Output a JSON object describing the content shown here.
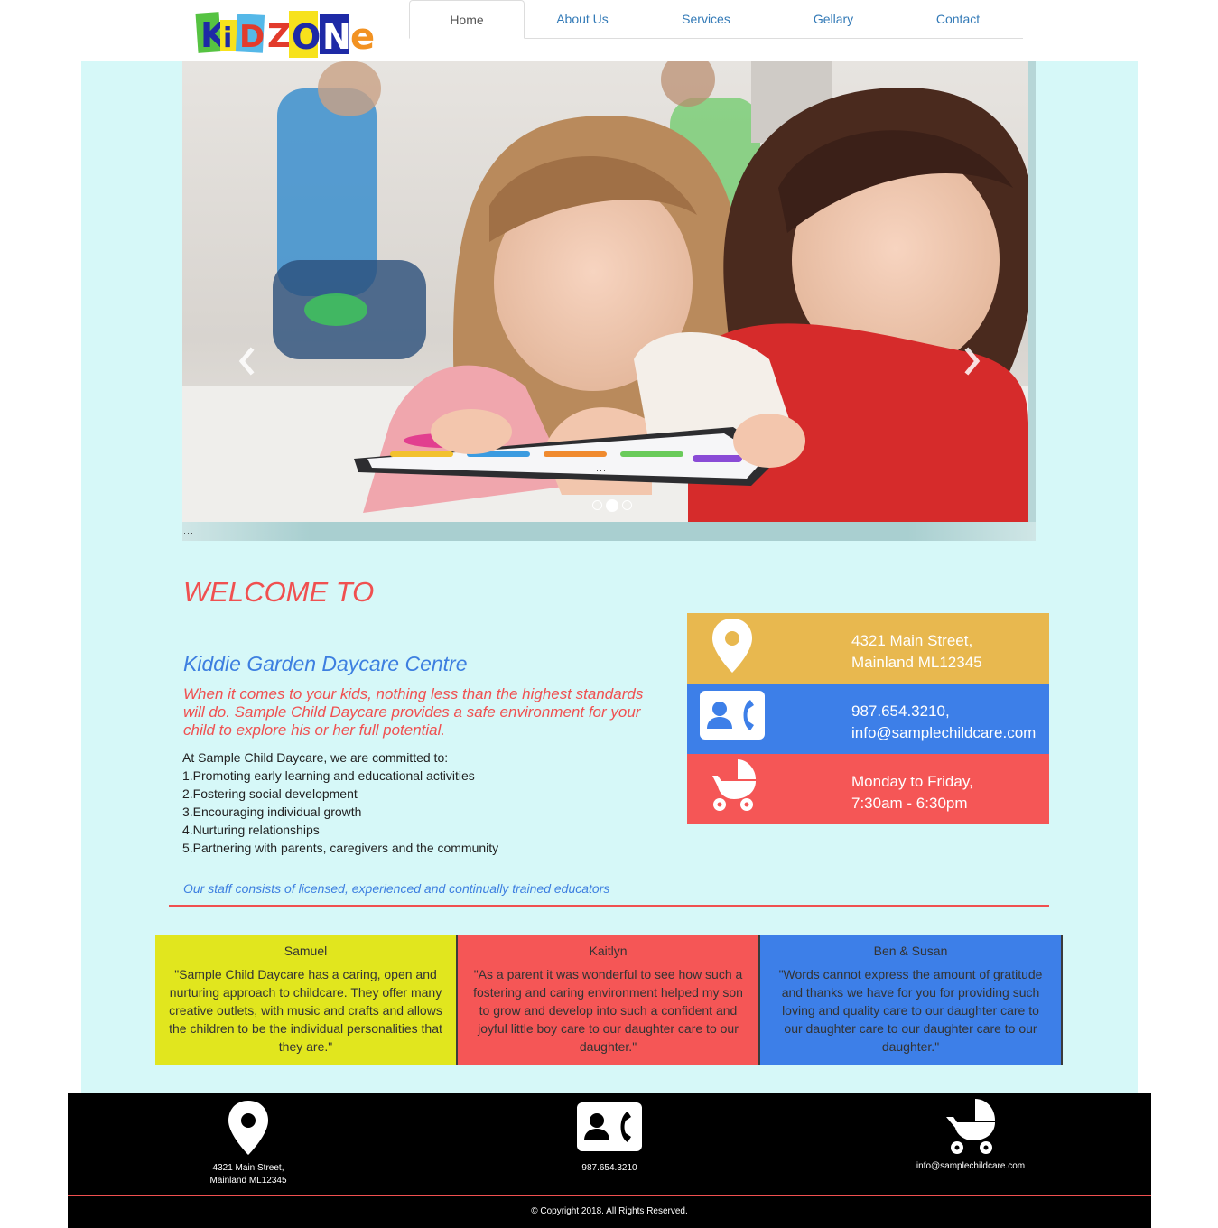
{
  "brand": {
    "logo_letters": [
      "K",
      "i",
      "D",
      "Z",
      "O",
      "N",
      "e"
    ]
  },
  "nav": {
    "items": [
      {
        "label": "Home",
        "active": true
      },
      {
        "label": "About Us",
        "active": false
      },
      {
        "label": "Services",
        "active": false
      },
      {
        "label": "Gellary",
        "active": false
      },
      {
        "label": "Contact",
        "active": false
      }
    ]
  },
  "slider": {
    "slide_count": 3,
    "active_slide": 2,
    "prev_icon": "chevron-left-icon",
    "next_icon": "chevron-right-icon"
  },
  "intro": {
    "welcome": "WELCOME TO",
    "centre_name": "Kiddie Garden Daycare Centre",
    "tagline": "When it comes to your kids, nothing less than the highest standards will do. Sample Child Daycare provides a safe environment for your child to explore his or her full potential.",
    "commit_lead": "At Sample Child Daycare, we are committed to:",
    "commitments": [
      "1.Promoting early learning and educational activities",
      "2.Fostering social development",
      "3.Encouraging individual growth",
      "4.Nurturing relationships",
      "5.Partnering with parents, caregivers and the community"
    ],
    "staff_note": "Our staff consists of licensed, experienced and continually trained educators"
  },
  "info": [
    {
      "icon": "map-pin-icon",
      "color": "#e8b84f",
      "line1": "4321 Main Street,",
      "line2": "Mainland ML12345"
    },
    {
      "icon": "contact-phone-icon",
      "color": "#3d7fe8",
      "line1": "987.654.3210,",
      "line2": "info@samplechildcare.com"
    },
    {
      "icon": "stroller-icon",
      "color": "#f55656",
      "line1": "Monday to Friday,",
      "line2": "7:30am - 6:30pm"
    }
  ],
  "testimonials": [
    {
      "name": "Samuel",
      "color": "#e1e61e",
      "quote": "\"Sample Child Daycare has a caring, open and nurturing approach to childcare. They offer many creative outlets, with music and crafts and allows the children to be the individual personalities that they are.\""
    },
    {
      "name": "Kaitlyn",
      "color": "#f55656",
      "quote": "\"As a parent it was wonderful to see how such a fostering and caring environment helped my son to grow and develop into such a confident and joyful little boy care to our daughter care to our daughter.\""
    },
    {
      "name": "Ben & Susan",
      "color": "#3d7fe8",
      "quote": "\"Words cannot express the amount of gratitude and thanks we have for you for providing such loving and quality care to our daughter care to our daughter care to our daughter care to our daughter.\""
    }
  ],
  "footer": {
    "address_line1": "4321 Main Street,",
    "address_line2": "Mainland ML12345",
    "phone": "987.654.3210",
    "email": "info@samplechildcare.com",
    "copyright": "© Copyright 2018. All Rights Reserved."
  }
}
